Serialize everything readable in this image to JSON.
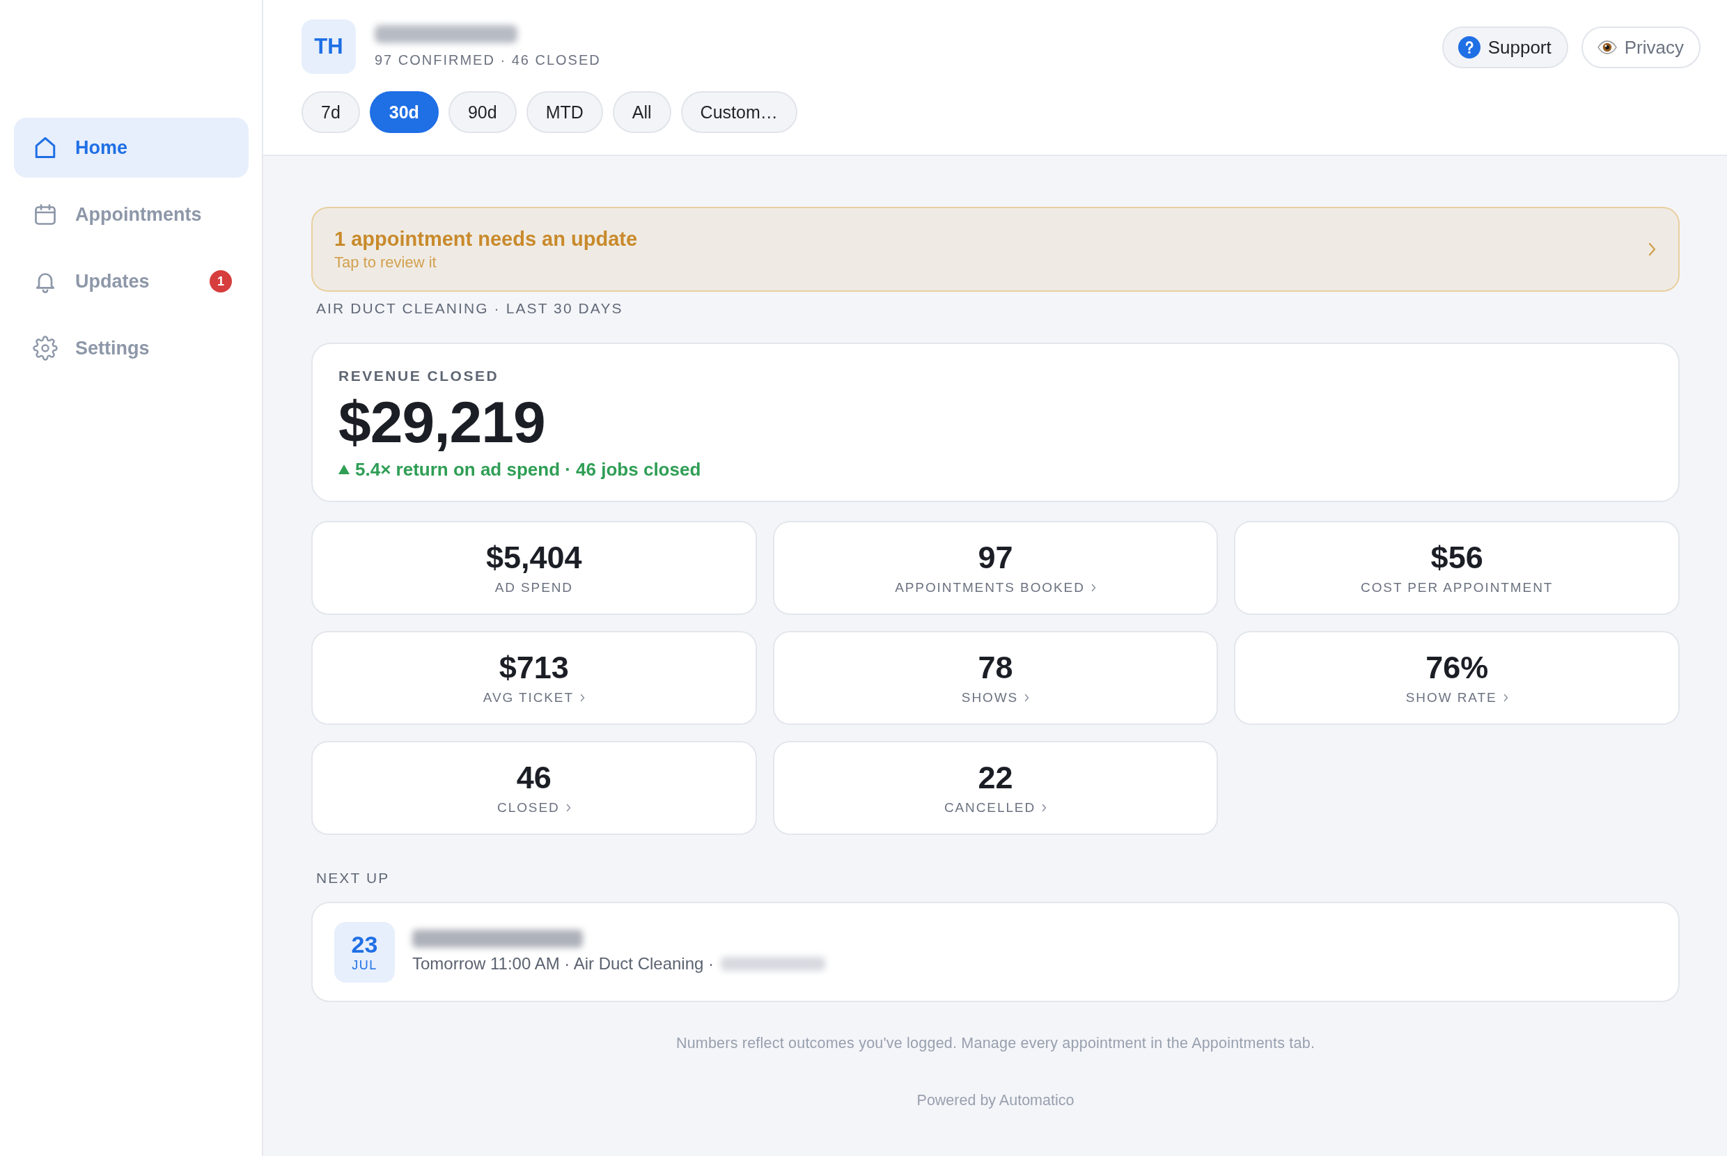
{
  "sidebar": {
    "items": [
      {
        "label": "Home",
        "selected": true
      },
      {
        "label": "Appointments",
        "selected": false
      },
      {
        "label": "Updates",
        "selected": false,
        "badge": "1"
      },
      {
        "label": "Settings",
        "selected": false
      }
    ]
  },
  "header": {
    "avatar": "TH",
    "summary": "97 CONFIRMED · 46 CLOSED",
    "periods": [
      {
        "label": "7d",
        "selected": false
      },
      {
        "label": "30d",
        "selected": true
      },
      {
        "label": "90d",
        "selected": false
      },
      {
        "label": "MTD",
        "selected": false
      },
      {
        "label": "All",
        "selected": false
      },
      {
        "label": "Custom…",
        "selected": false
      }
    ],
    "actions": [
      {
        "label": "Support",
        "kind": "filled"
      },
      {
        "label": "Privacy",
        "kind": "outline"
      }
    ]
  },
  "alert": {
    "title": "1 appointment needs an update",
    "subtitle": "Tap to review it"
  },
  "section_title": "AIR DUCT CLEANING · LAST 30 DAYS",
  "revenue": {
    "label": "REVENUE CLOSED",
    "value": "$29,219",
    "trend_up": true,
    "trend": "5.4× return on ad spend · 46 jobs closed"
  },
  "stats": [
    {
      "value": "$5,404",
      "label": "AD SPEND",
      "linked": false
    },
    {
      "value": "97",
      "label": "APPOINTMENTS BOOKED",
      "linked": true
    },
    {
      "value": "$56",
      "label": "COST PER APPOINTMENT",
      "linked": false
    },
    {
      "value": "$713",
      "label": "AVG TICKET",
      "linked": true
    },
    {
      "value": "78",
      "label": "SHOWS",
      "linked": true
    },
    {
      "value": "76%",
      "label": "SHOW RATE",
      "linked": true
    },
    {
      "value": "46",
      "label": "CLOSED",
      "linked": true
    },
    {
      "value": "22",
      "label": "CANCELLED",
      "linked": true
    }
  ],
  "next_up": {
    "title": "NEXT UP",
    "day": "23",
    "month": "JUL",
    "details": "Tomorrow 11:00 AM · Air Duct Cleaning ·"
  },
  "footer": {
    "note": "Numbers reflect outcomes you've logged. Manage every appointment in the Appointments tab.",
    "powered_by": "Powered by Automatico"
  }
}
